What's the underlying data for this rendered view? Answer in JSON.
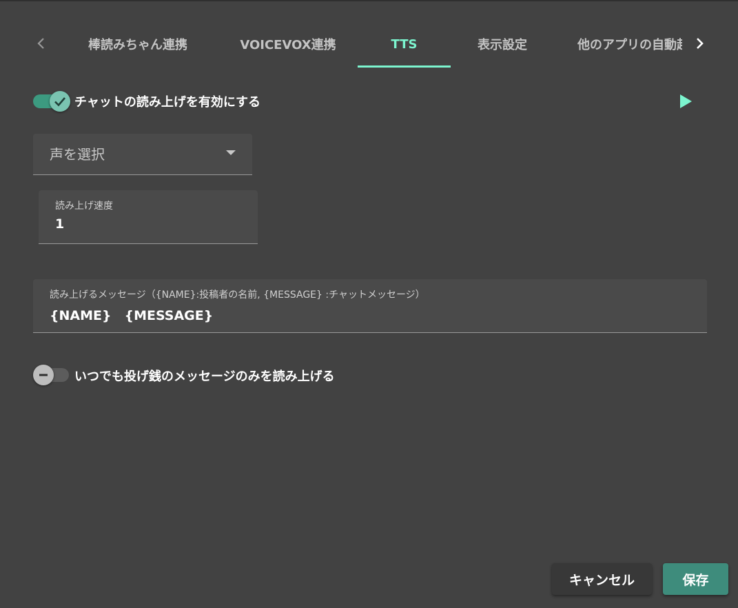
{
  "tabs": {
    "items": [
      {
        "label": "棒読みちゃん連携",
        "active": false
      },
      {
        "label": "VOICEVOX連携",
        "active": false
      },
      {
        "label": "TTS",
        "active": true
      },
      {
        "label": "表示設定",
        "active": false
      },
      {
        "label": "他のアプリの自動起動",
        "active": false
      }
    ],
    "prev_icon": "chevron-left-icon",
    "next_icon": "chevron-right-icon"
  },
  "tts_toggle": {
    "label": "チャットの読み上げを有効にする",
    "checked": true,
    "icon": "check-icon"
  },
  "play_icon": "play-icon",
  "voice_select": {
    "placeholder": "声を選択",
    "icon": "caret-down-icon"
  },
  "speed_field": {
    "label": "読み上げ速度",
    "value": "1"
  },
  "message_field": {
    "label": "読み上げるメッセージ（{NAME}:投稿者の名前, {MESSAGE} :チャットメッセージ）",
    "value": "{NAME}　{MESSAGE}"
  },
  "donation_toggle": {
    "label": "いつでも投げ銭のメッセージのみを読み上げる",
    "checked": false,
    "icon": "minus-icon"
  },
  "footer": {
    "cancel_label": "キャンセル",
    "save_label": "保存"
  },
  "colors": {
    "background": "#424242",
    "accent": "#7cf5cf",
    "switch_on": "#3c9a80",
    "save_button": "#3e8c7c"
  }
}
